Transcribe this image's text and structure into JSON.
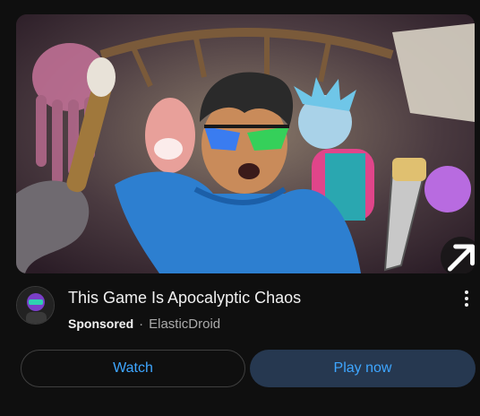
{
  "ad": {
    "title": "This Game Is Apocalyptic Chaos",
    "sponsored_label": "Sponsored",
    "separator": "·",
    "advertiser": "ElasticDroid"
  },
  "buttons": {
    "watch": "Watch",
    "play_now": "Play now"
  },
  "icons": {
    "open": "arrow-up-right-icon",
    "menu": "more-vert-icon"
  },
  "colors": {
    "background": "#0f0f0f",
    "accent_blue": "#3ea6ff",
    "play_button_bg": "#263850",
    "secondary_text": "#aaaaaa"
  }
}
